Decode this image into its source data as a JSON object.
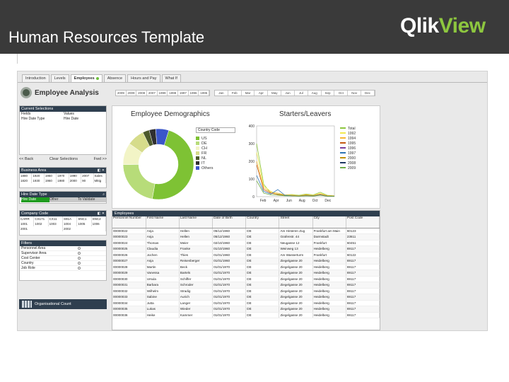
{
  "slide": {
    "title": "Human Resources Template",
    "logo_part1": "Qlik",
    "logo_part2": "View"
  },
  "tabs": [
    "Introduction",
    "Levels",
    "Employees",
    "Absence",
    "Hours and Pay",
    "What If"
  ],
  "active_tab": "Employees",
  "sheet_title": "Employee Analysis",
  "years": [
    "2009",
    "2009",
    "2008",
    "2007",
    "1999",
    "1998",
    "1997",
    "1996",
    "1995"
  ],
  "months": [
    "Jan",
    "Feb",
    "Mar",
    "Apr",
    "May",
    "Jun",
    "Jul",
    "Aug",
    "Sep",
    "Oct",
    "Nov",
    "Dec"
  ],
  "current_selections": {
    "header": "Current Selections",
    "col1": "Fields",
    "col2": "Values",
    "rows": [
      {
        "field": "Hire Date Type",
        "value": "Hire Date"
      }
    ],
    "back": "<< Back",
    "clear": "Clear Selections",
    "forward": "Fwd >>"
  },
  "business_area": {
    "header": "Business Area",
    "cells": [
      "1880",
      "1920",
      "1950",
      "1970",
      "1990",
      "2007",
      "Sales",
      "1820",
      "1930",
      "1960",
      "1980",
      "2000",
      "90",
      "Mktg"
    ]
  },
  "hire_date_type": {
    "header": "Hire Date Type",
    "options": [
      "Hire Date",
      "Other",
      "To Validate"
    ]
  },
  "company_code": {
    "header": "Company Code",
    "cells": [
      "CARR",
      "CS171",
      "CX11",
      "S91A",
      "SNC1",
      "SNC2",
      "1001",
      "1002",
      "1003",
      "1004",
      "1005",
      "1006",
      "2001",
      "2002"
    ]
  },
  "filters": {
    "header": "Filters",
    "rows": [
      "Personnel Area",
      "Supervisor Area",
      "Cost Center",
      "Country",
      "Job Role"
    ]
  },
  "org_count": "Organisational Count",
  "demographics": {
    "title": "Employee Demographics",
    "dropdown": "Country Code",
    "legend": [
      {
        "label": "US",
        "color": "#7ec234"
      },
      {
        "label": "DE",
        "color": "#b7dc79"
      },
      {
        "label": "CH",
        "color": "#f2f4c6"
      },
      {
        "label": "FR",
        "color": "#d6dc8b"
      },
      {
        "label": "NL",
        "color": "#4c5a2c"
      },
      {
        "label": "IT",
        "color": "#2f2f2f"
      },
      {
        "label": "Others",
        "color": "#3a56c8"
      }
    ],
    "slices": [
      {
        "label": "US",
        "value": 48,
        "color": "#7ec234"
      },
      {
        "label": "DE",
        "value": 22,
        "color": "#b7dc79"
      },
      {
        "label": "CH",
        "value": 10,
        "color": "#f2f4c6"
      },
      {
        "label": "FR",
        "value": 8,
        "color": "#d6dc8b"
      },
      {
        "label": "NL",
        "value": 3,
        "color": "#4c5a2c"
      },
      {
        "label": "IT",
        "value": 3,
        "color": "#2f2f2f"
      },
      {
        "label": "Others",
        "value": 6,
        "color": "#3a56c8"
      }
    ]
  },
  "starters": {
    "title": "Starters/Leavers",
    "y_ticks": [
      "400",
      "300",
      "200",
      "100",
      "0"
    ],
    "x_ticks": [
      "Feb",
      "Apr",
      "Jun",
      "Aug",
      "Oct",
      "Dec"
    ],
    "legend": [
      {
        "label": "Total",
        "color": "#8dc63f"
      },
      {
        "label": "1992",
        "color": "#f2e94e"
      },
      {
        "label": "1994",
        "color": "#f7b733"
      },
      {
        "label": "1995",
        "color": "#c55a11"
      },
      {
        "label": "1996",
        "color": "#7a3e9d"
      },
      {
        "label": "1997",
        "color": "#2e75b6"
      },
      {
        "label": "2000",
        "color": "#bf9000"
      },
      {
        "label": "2008",
        "color": "#1f3864"
      },
      {
        "label": "2009",
        "color": "#70ad47"
      }
    ]
  },
  "chart_data": {
    "type": "line",
    "title": "Starters/Leavers",
    "categories": [
      "Jan",
      "Feb",
      "Mar",
      "Apr",
      "May",
      "Jun",
      "Jul",
      "Aug",
      "Sep",
      "Oct",
      "Nov",
      "Dec"
    ],
    "ylim": [
      0,
      400
    ],
    "series": [
      {
        "name": "Total",
        "color": "#8dc63f",
        "values": [
          300,
          70,
          20,
          15,
          10,
          12,
          8,
          15,
          10,
          25,
          8,
          5
        ]
      },
      {
        "name": "1992",
        "color": "#f2e94e",
        "values": [
          250,
          60,
          30,
          10,
          8,
          10,
          6,
          12,
          8,
          20,
          6,
          4
        ]
      },
      {
        "name": "1994",
        "color": "#f7b733",
        "values": [
          200,
          50,
          25,
          20,
          10,
          8,
          5,
          10,
          6,
          15,
          5,
          3
        ]
      },
      {
        "name": "1995",
        "color": "#c55a11",
        "values": [
          180,
          40,
          20,
          12,
          6,
          6,
          4,
          8,
          5,
          12,
          4,
          3
        ]
      },
      {
        "name": "1997",
        "color": "#2e75b6",
        "values": [
          120,
          30,
          15,
          40,
          8,
          5,
          3,
          6,
          4,
          10,
          3,
          2
        ]
      },
      {
        "name": "2009",
        "color": "#70ad47",
        "values": [
          90,
          20,
          10,
          8,
          5,
          4,
          3,
          5,
          3,
          8,
          2,
          2
        ]
      }
    ]
  },
  "employees": {
    "header": "Employees",
    "columns": [
      "Personnel Number",
      "First Name",
      "Last Name",
      "Date of Birth",
      "Country",
      "Street",
      "City",
      "Post Code"
    ],
    "rows": [
      [
        "00000022",
        "Anja",
        "Hellen",
        "05/12/1960",
        "DE",
        "Am Hinteren Zug",
        "Frankfurt am Main",
        "60123"
      ],
      [
        "00000023",
        "Anja",
        "Hellen",
        "05/12/1960",
        "DE",
        "Grafenstr. 44",
        "Darmstadt",
        "23611"
      ],
      [
        "00000024",
        "Thomas",
        "Meier",
        "02/10/1960",
        "DE",
        "Neugasse 12",
        "Frankfurt",
        "60451"
      ],
      [
        "00000025",
        "Claudia",
        "Franke",
        "01/10/1960",
        "DE",
        "Weinweg 13",
        "Heidelberg",
        "69117"
      ],
      [
        "00000026",
        "Jochen",
        "Thies",
        "01/01/1960",
        "DE",
        "Am Wasserturm",
        "Frankfurt",
        "60122"
      ],
      [
        "00000027",
        "Anja",
        "Reisenberger",
        "01/01/1960",
        "DE",
        "Ziegelgasse 20",
        "Heidelberg",
        "69117"
      ],
      [
        "00000028",
        "Martin",
        "Beck",
        "01/01/1970",
        "DE",
        "Ziegelgasse 20",
        "Heidelberg",
        "69117"
      ],
      [
        "00000029",
        "Vanessa",
        "Bartels",
        "01/01/1970",
        "DE",
        "Ziegelgasse 20",
        "Heidelberg",
        "69117"
      ],
      [
        "00000030",
        "Ursula",
        "Schiffer",
        "01/01/1970",
        "DE",
        "Ziegelgasse 20",
        "Heidelberg",
        "69117"
      ],
      [
        "00000031",
        "Barbara",
        "Schroder",
        "01/01/1970",
        "DE",
        "Ziegelgasse 20",
        "Heidelberg",
        "69117"
      ],
      [
        "00000032",
        "Wilhelm",
        "Stradig",
        "01/01/1970",
        "DE",
        "Ziegelgasse 20",
        "Heidelberg",
        "69117"
      ],
      [
        "00000033",
        "Sabine",
        "Aurich",
        "01/01/1970",
        "DE",
        "Ziegelgasse 20",
        "Heidelberg",
        "69117"
      ],
      [
        "00000034",
        "Jutta",
        "Langer",
        "01/01/1970",
        "DE",
        "Ziegelgasse 20",
        "Heidelberg",
        "69117"
      ],
      [
        "00000035",
        "Lukas",
        "Wieder",
        "01/01/1970",
        "DE",
        "Ziegelgasse 20",
        "Heidelberg",
        "69117"
      ],
      [
        "00000036",
        "Heike",
        "Kammer",
        "01/01/1970",
        "DE",
        "Ziegelgasse 20",
        "Heidelberg",
        "69117"
      ]
    ]
  }
}
